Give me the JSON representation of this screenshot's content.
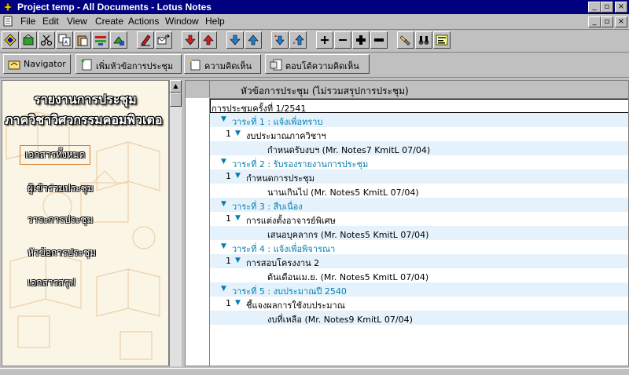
{
  "window": {
    "title": "Project temp - All Documents - Lotus Notes",
    "controls": [
      "_",
      "▫",
      "×"
    ]
  },
  "menu": [
    "File",
    "Edit",
    "View",
    "Create",
    "Actions",
    "Window",
    "Help"
  ],
  "actions": [
    {
      "label": "Navigator",
      "icon": "navigator-icon"
    },
    {
      "label": "เพิ่มหัวข้อการประชุม",
      "icon": "new-topic-icon"
    },
    {
      "label": "ความคิดเห็น",
      "icon": "comment-icon"
    },
    {
      "label": "ตอบโต้ความคิดเห็น",
      "icon": "reply-icon"
    }
  ],
  "navigator": {
    "title_line1": "รายงานการประชุม",
    "title_line2": "ภาควิชาวิศวกรรมคอมพิวเตอ",
    "links": [
      "เอกสารทั้งหมด",
      "ผู้เข้าร่วมประชุม",
      "วาระการประชุม",
      "หัวข้อการประชุม",
      "เอกสารสรุป"
    ],
    "selected": "เอกสารทั้งหมด"
  },
  "view": {
    "column_header": "หัวข้อการประชุม (ไม่รวมสรุปการประชุม)",
    "rows": [
      {
        "indent": 0,
        "num": "",
        "twistie": false,
        "text": "การประชุมครั้งที่ 1/2541",
        "cat": true,
        "selected": true
      },
      {
        "indent": 1,
        "num": "",
        "twistie": true,
        "text": "วาระที่ 1 : แจ้งเพื่อทราบ",
        "cat": true
      },
      {
        "indent": 2,
        "num": "1",
        "twistie": true,
        "text": "งบประมาณภาควิชาฯ",
        "cat": false
      },
      {
        "indent": 3,
        "num": "",
        "twistie": false,
        "text": "กำหนดรับงบฯ  (Mr. Notes7 KmitL 07/04)",
        "cat": false
      },
      {
        "indent": 1,
        "num": "",
        "twistie": true,
        "text": "วาระที่ 2 : รับรองรายงานการประชุม",
        "cat": true
      },
      {
        "indent": 2,
        "num": "1",
        "twistie": true,
        "text": "กำหนดการประชุม",
        "cat": false
      },
      {
        "indent": 3,
        "num": "",
        "twistie": false,
        "text": "นานเกินไป  (Mr. Notes5 KmitL 07/04)",
        "cat": false
      },
      {
        "indent": 1,
        "num": "",
        "twistie": true,
        "text": "วาระที่ 3 : สืบเนื่อง",
        "cat": true
      },
      {
        "indent": 2,
        "num": "1",
        "twistie": true,
        "text": "การแต่งตั้งอาจารย์พิเศษ",
        "cat": false
      },
      {
        "indent": 3,
        "num": "",
        "twistie": false,
        "text": "เสนอบุคลากร  (Mr. Notes5 KmitL 07/04)",
        "cat": false
      },
      {
        "indent": 1,
        "num": "",
        "twistie": true,
        "text": "วาระที่ 4 : แจ้งเพื่อพิจารณา",
        "cat": true
      },
      {
        "indent": 2,
        "num": "1",
        "twistie": true,
        "text": "การสอบโครงงาน 2",
        "cat": false
      },
      {
        "indent": 3,
        "num": "",
        "twistie": false,
        "text": "ต้นเดือนเม.ย.  (Mr. Notes5 KmitL 07/04)",
        "cat": false
      },
      {
        "indent": 1,
        "num": "",
        "twistie": true,
        "text": "วาระที่ 5 : งบประมาณปี 2540",
        "cat": true
      },
      {
        "indent": 2,
        "num": "1",
        "twistie": true,
        "text": "ชี้แจงผลการใช้งบประมาณ",
        "cat": false
      },
      {
        "indent": 3,
        "num": "",
        "twistie": false,
        "text": "งบที่เหลือ  (Mr. Notes9 KmitL 07/04)",
        "cat": false
      }
    ]
  },
  "colors": {
    "titlebar": "#000080",
    "category_text": "#0080b0",
    "alt_row": "#e6f2fb"
  }
}
